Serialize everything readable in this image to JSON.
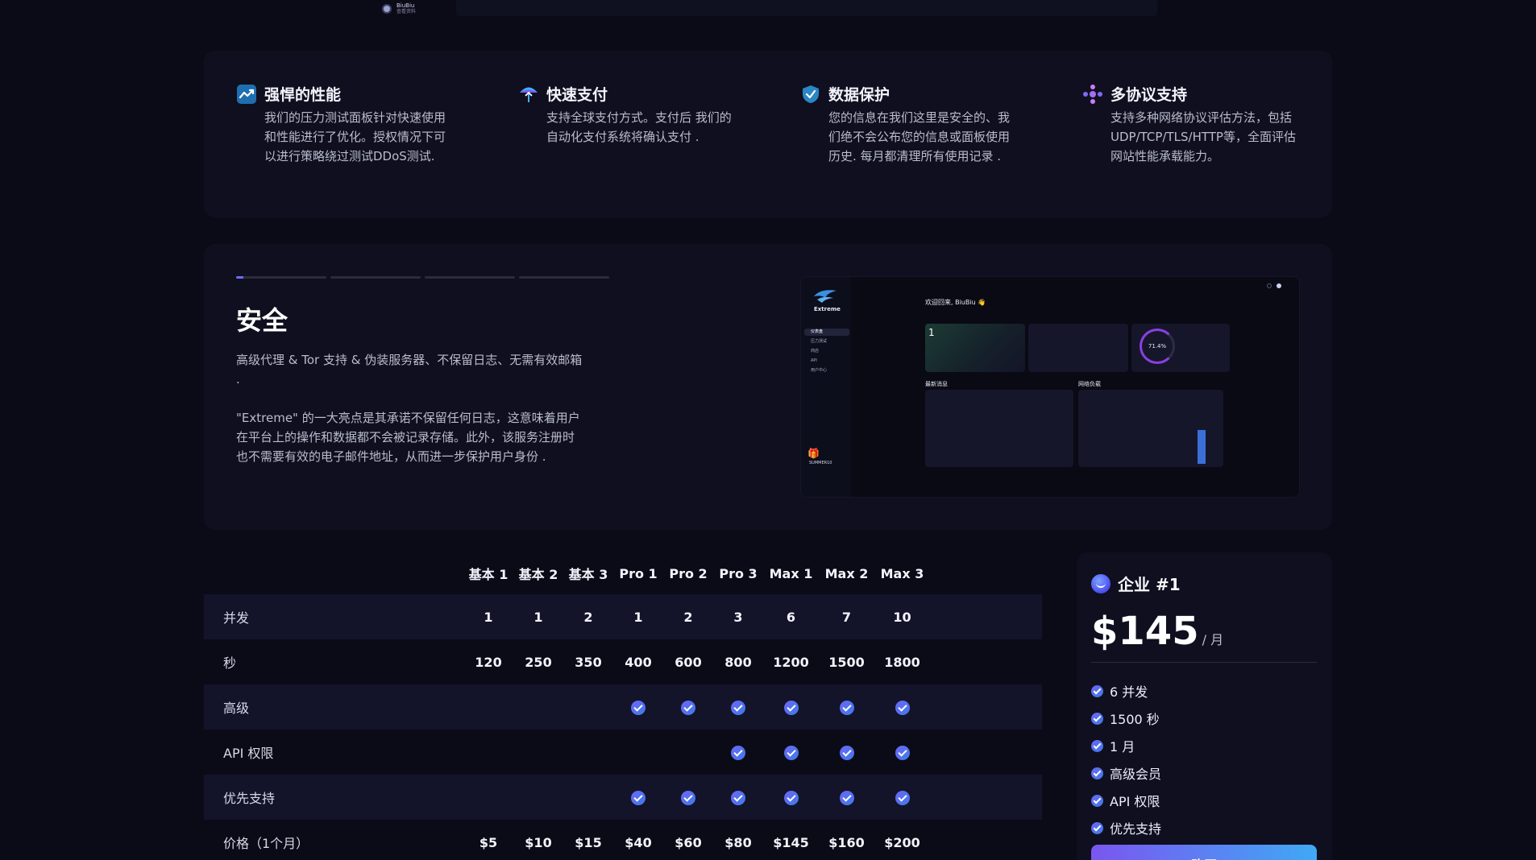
{
  "topbar": {
    "user_name": "BiuBiu",
    "user_sub": "查看资料"
  },
  "features": [
    {
      "icon": "performance-chart-icon",
      "title": "强悍的性能",
      "desc": "我们的压力测试面板针对快速使用和性能进行了优化。授权情况下可以进行策略绕过测试DDoS测试."
    },
    {
      "icon": "umbrella-payment-icon",
      "title": "快速支付",
      "desc": "支持全球支付方式。支付后 我们的自动化支付系统将确认支付 ."
    },
    {
      "icon": "shield-check-icon",
      "title": "数据保护",
      "desc": "您的信息在我们这里是安全的、我们绝不会公布您的信息或面板使用历史. 每月都清理所有使用记录 ."
    },
    {
      "icon": "protocol-dots-icon",
      "title": "多协议支持",
      "desc": "支持多种网络协议评估方法，包括UDP/TCP/TLS/HTTP等，全面评估网站性能承载能力。"
    }
  ],
  "security": {
    "slides_total": 4,
    "active_slide": 1,
    "active_progress": 0.08,
    "title": "安全",
    "para1": "高级代理 & Tor 支持 & 伪装服务器、不保留日志、无需有效邮箱 .",
    "para2": "\"Extreme\" 的一大亮点是其承诺不保留任何日志，这意味着用户在平台上的操作和数据都不会被记录存储。此外，该服务注册时也不需要有效的电子邮件地址，从而进一步保护用户身份 ."
  },
  "preview": {
    "logo_text": "Extreme",
    "nav": [
      "仪表盘",
      "压力测试",
      "商店",
      "API",
      "用户中心"
    ],
    "welcome": "欢迎回来, BiuBiu 👋",
    "card_number": "1",
    "ring_value": "71.4%",
    "news_label": "最新消息",
    "load_label": "网络负载",
    "promo": "SUMMER10"
  },
  "pricing": {
    "columns": [
      "基本 1",
      "基本 2",
      "基本 3",
      "Pro 1",
      "Pro 2",
      "Pro 3",
      "Max 1",
      "Max 2",
      "Max 3"
    ],
    "rows": [
      {
        "label": "并发",
        "type": "text",
        "values": [
          "1",
          "1",
          "2",
          "1",
          "2",
          "3",
          "6",
          "7",
          "10"
        ]
      },
      {
        "label": "秒",
        "type": "text",
        "values": [
          "120",
          "250",
          "350",
          "400",
          "600",
          "800",
          "1200",
          "1500",
          "1800"
        ]
      },
      {
        "label": "高级",
        "type": "check",
        "values": [
          false,
          false,
          false,
          true,
          true,
          true,
          true,
          true,
          true
        ]
      },
      {
        "label": "API 权限",
        "type": "check",
        "values": [
          false,
          false,
          false,
          false,
          false,
          true,
          true,
          true,
          true
        ]
      },
      {
        "label": "优先支持",
        "type": "check",
        "values": [
          false,
          false,
          false,
          true,
          true,
          true,
          true,
          true,
          true
        ]
      },
      {
        "label": "价格（1个月）",
        "type": "text",
        "values": [
          "$5",
          "$10",
          "$15",
          "$40",
          "$60",
          "$80",
          "$145",
          "$160",
          "$200"
        ]
      }
    ]
  },
  "enterprise": {
    "title": "企业 #1",
    "price": "$145",
    "period": "/ 月",
    "features": [
      "6 并发",
      "1500 秒",
      "1 月",
      "高级会员",
      "API 权限",
      "优先支持"
    ],
    "buy_label": "购买"
  },
  "colors": {
    "background": "#0b0b18",
    "panel": "#0f0f1f",
    "accent": "#6b6cf6",
    "check": "#5b6ef2"
  }
}
